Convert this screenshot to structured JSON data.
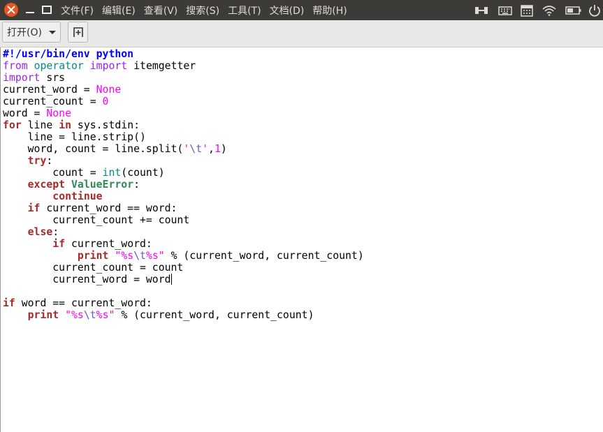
{
  "menubar": {
    "items": [
      "文件(F)",
      "编辑(E)",
      "查看(V)",
      "搜索(S)",
      "工具(T)",
      "文档(D)",
      "帮助(H)"
    ]
  },
  "window_controls": {
    "close_icon": "close-icon",
    "minimize_icon": "minimize-icon",
    "maximize_icon": "maximize-icon"
  },
  "indicators": [
    "bluetooth-icon",
    "keyboard-icon",
    "calendar-icon",
    "wifi-icon",
    "battery-icon",
    "power-icon"
  ],
  "toolbar": {
    "open_label": "打开(O)",
    "new_tab_icon": "new-document-icon"
  },
  "colors": {
    "menubar_bg": "#3c3b37",
    "close_button": "#e95420",
    "keyword": "#a52a2a",
    "string": "#ff00ff",
    "builtin": "#008b8b"
  },
  "editor": {
    "lines": [
      "#!/usr/bin/env python",
      "from operator import itemgetter",
      "import srs",
      "current_word = None",
      "current_count = 0",
      "word = None",
      "for line in sys.stdin:",
      "    line = line.strip()",
      "    word, count = line.split('\\t',1)",
      "    try:",
      "        count = int(count)",
      "    except ValueError:",
      "        continue",
      "    if current_word == word:",
      "        current_count += count",
      "    else:",
      "        if current_word:",
      "            print \"%s\\t%s\" % (current_word, current_count)",
      "        current_count = count",
      "        current_word = word",
      "",
      "if word == current_word:",
      "    print \"%s\\t%s\" % (current_word, current_count)"
    ]
  }
}
